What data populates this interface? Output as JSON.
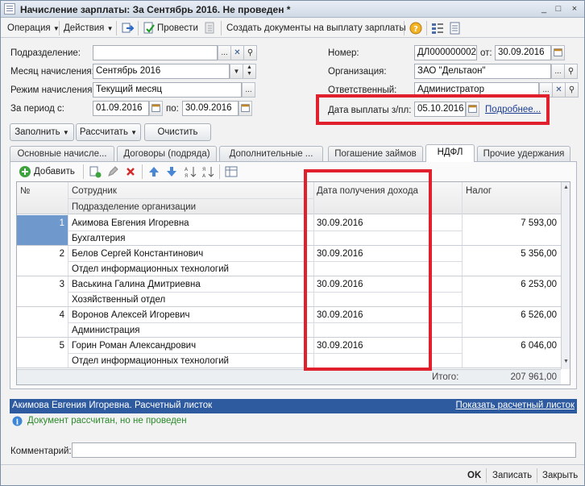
{
  "window": {
    "title": "Начисление зарплаты: За Сентябрь 2016. Не проведен *",
    "controls": [
      "_",
      "□",
      "×"
    ]
  },
  "toolbar": {
    "operation": "Операция",
    "actions": "Действия",
    "post": "Провести",
    "create_docs": "Создать документы на выплату зарплаты"
  },
  "header": {
    "department_label": "Подразделение:",
    "department_value": "",
    "month_label": "Месяц начисления:",
    "month_value": "Сентябрь 2016",
    "mode_label": "Режим начисления:",
    "mode_value": "Текущий месяц",
    "period_label": "За период с:",
    "period_from": "01.09.2016",
    "period_to_label": "по:",
    "period_to": "30.09.2016",
    "number_label": "Номер:",
    "number_value": "ДЛ000000002",
    "date_label": "от:",
    "date_value": "30.09.2016",
    "org_label": "Организация:",
    "org_value": "ЗАО \"Дельтаон\"",
    "resp_label": "Ответственный:",
    "resp_value": "Администратор",
    "paydate_label": "Дата выплаты з/пл:",
    "paydate_value": "05.10.2016",
    "more_link": "Подробнее..."
  },
  "buttons": {
    "fill": "Заполнить",
    "calculate": "Рассчитать",
    "clear": "Очистить"
  },
  "tabs": [
    {
      "label": "Основные начисле..."
    },
    {
      "label": "Договоры (подряда)"
    },
    {
      "label": "Дополнительные ..."
    },
    {
      "label": "Погашение займов"
    },
    {
      "label": "НДФЛ"
    },
    {
      "label": "Прочие удержания"
    }
  ],
  "grid_toolbar": {
    "add": "Добавить"
  },
  "grid": {
    "columns": {
      "num": "№",
      "employee": "Сотрудник",
      "department": "Подразделение организации",
      "income_date": "Дата получения дохода",
      "tax": "Налог"
    },
    "rows": [
      {
        "num": "1",
        "employee": "Акимова Евгения Игоревна",
        "department": "Бухгалтерия",
        "income_date": "30.09.2016",
        "tax": "7 593,00"
      },
      {
        "num": "2",
        "employee": "Белов Сергей Константинович",
        "department": "Отдел информационных технологий",
        "income_date": "30.09.2016",
        "tax": "5 356,00"
      },
      {
        "num": "3",
        "employee": "Васькина Галина Дмитриевна",
        "department": "Хозяйственный отдел",
        "income_date": "30.09.2016",
        "tax": "6 253,00"
      },
      {
        "num": "4",
        "employee": "Воронов Алексей Игоревич",
        "department": "Администрация",
        "income_date": "30.09.2016",
        "tax": "6 526,00"
      },
      {
        "num": "5",
        "employee": "Горин Роман Александрович",
        "department": "Отдел информационных технологий",
        "income_date": "30.09.2016",
        "tax": "6 046,00"
      }
    ],
    "total_label": "Итого:",
    "total_value": "207 961,00"
  },
  "status": {
    "sheet_text": "Акимова Евгения Игоревна. Расчетный листок",
    "show_sheet_link": "Показать расчетный листок",
    "info_text": "Документ рассчитан, но не проведен"
  },
  "comment": {
    "label": "Комментарий:",
    "value": ""
  },
  "footer": {
    "ok": "OK",
    "save": "Записать",
    "close": "Закрыть"
  },
  "colors": {
    "highlight": "#e0202c",
    "selection": "#6f98cd",
    "status_bar": "#2e5aa0"
  }
}
